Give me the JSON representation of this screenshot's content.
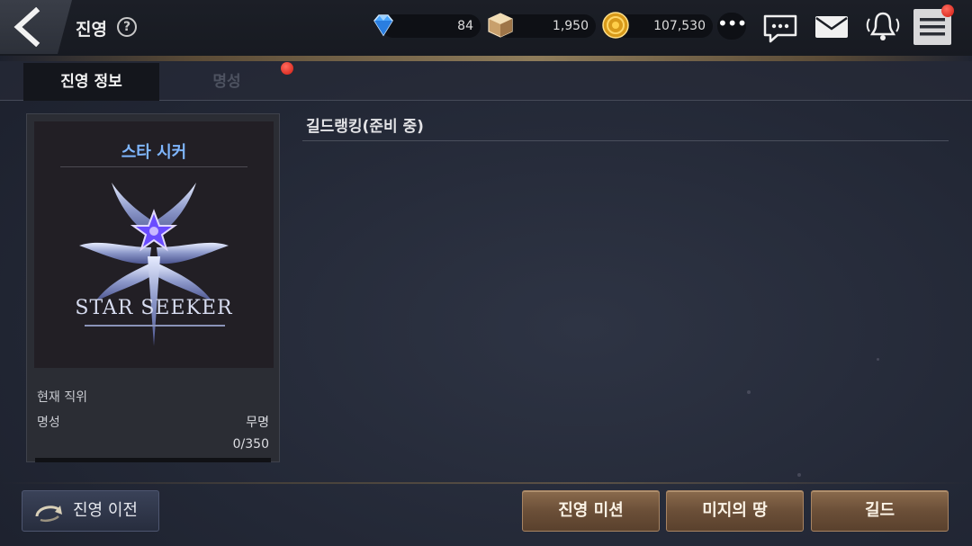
{
  "header": {
    "title": "진영",
    "help_icon": "?",
    "currencies": [
      {
        "icon": "diamond-icon",
        "value": "84"
      },
      {
        "icon": "crystal-cube-icon",
        "value": "1,950"
      },
      {
        "icon": "gold-coin-icon",
        "value": "107,530"
      }
    ],
    "more_label": "•••",
    "icons": [
      "chat-icon",
      "mail-icon",
      "bell-icon",
      "menu-icon"
    ]
  },
  "tabs": [
    {
      "label": "진영 정보",
      "active": true
    },
    {
      "label": "명성",
      "active": false,
      "badge": true
    }
  ],
  "faction_card": {
    "name": "스타 시커",
    "emblem_name": "STAR SEEKER",
    "current_rank_label": "현재 직위",
    "fame_label": "명성",
    "fame_value": "무명",
    "fame_progress": "0/350",
    "fame_progress_fraction": 0
  },
  "main": {
    "section_title": "길드랭킹(준비 중)"
  },
  "footer": {
    "transfer_label": "진영 이전",
    "buttons": [
      "진영 미션",
      "미지의 땅",
      "길드"
    ]
  },
  "colors": {
    "accent_blue": "#7fb6ff",
    "badge_red": "#d11a10",
    "button_brown": "#6b4f38"
  }
}
